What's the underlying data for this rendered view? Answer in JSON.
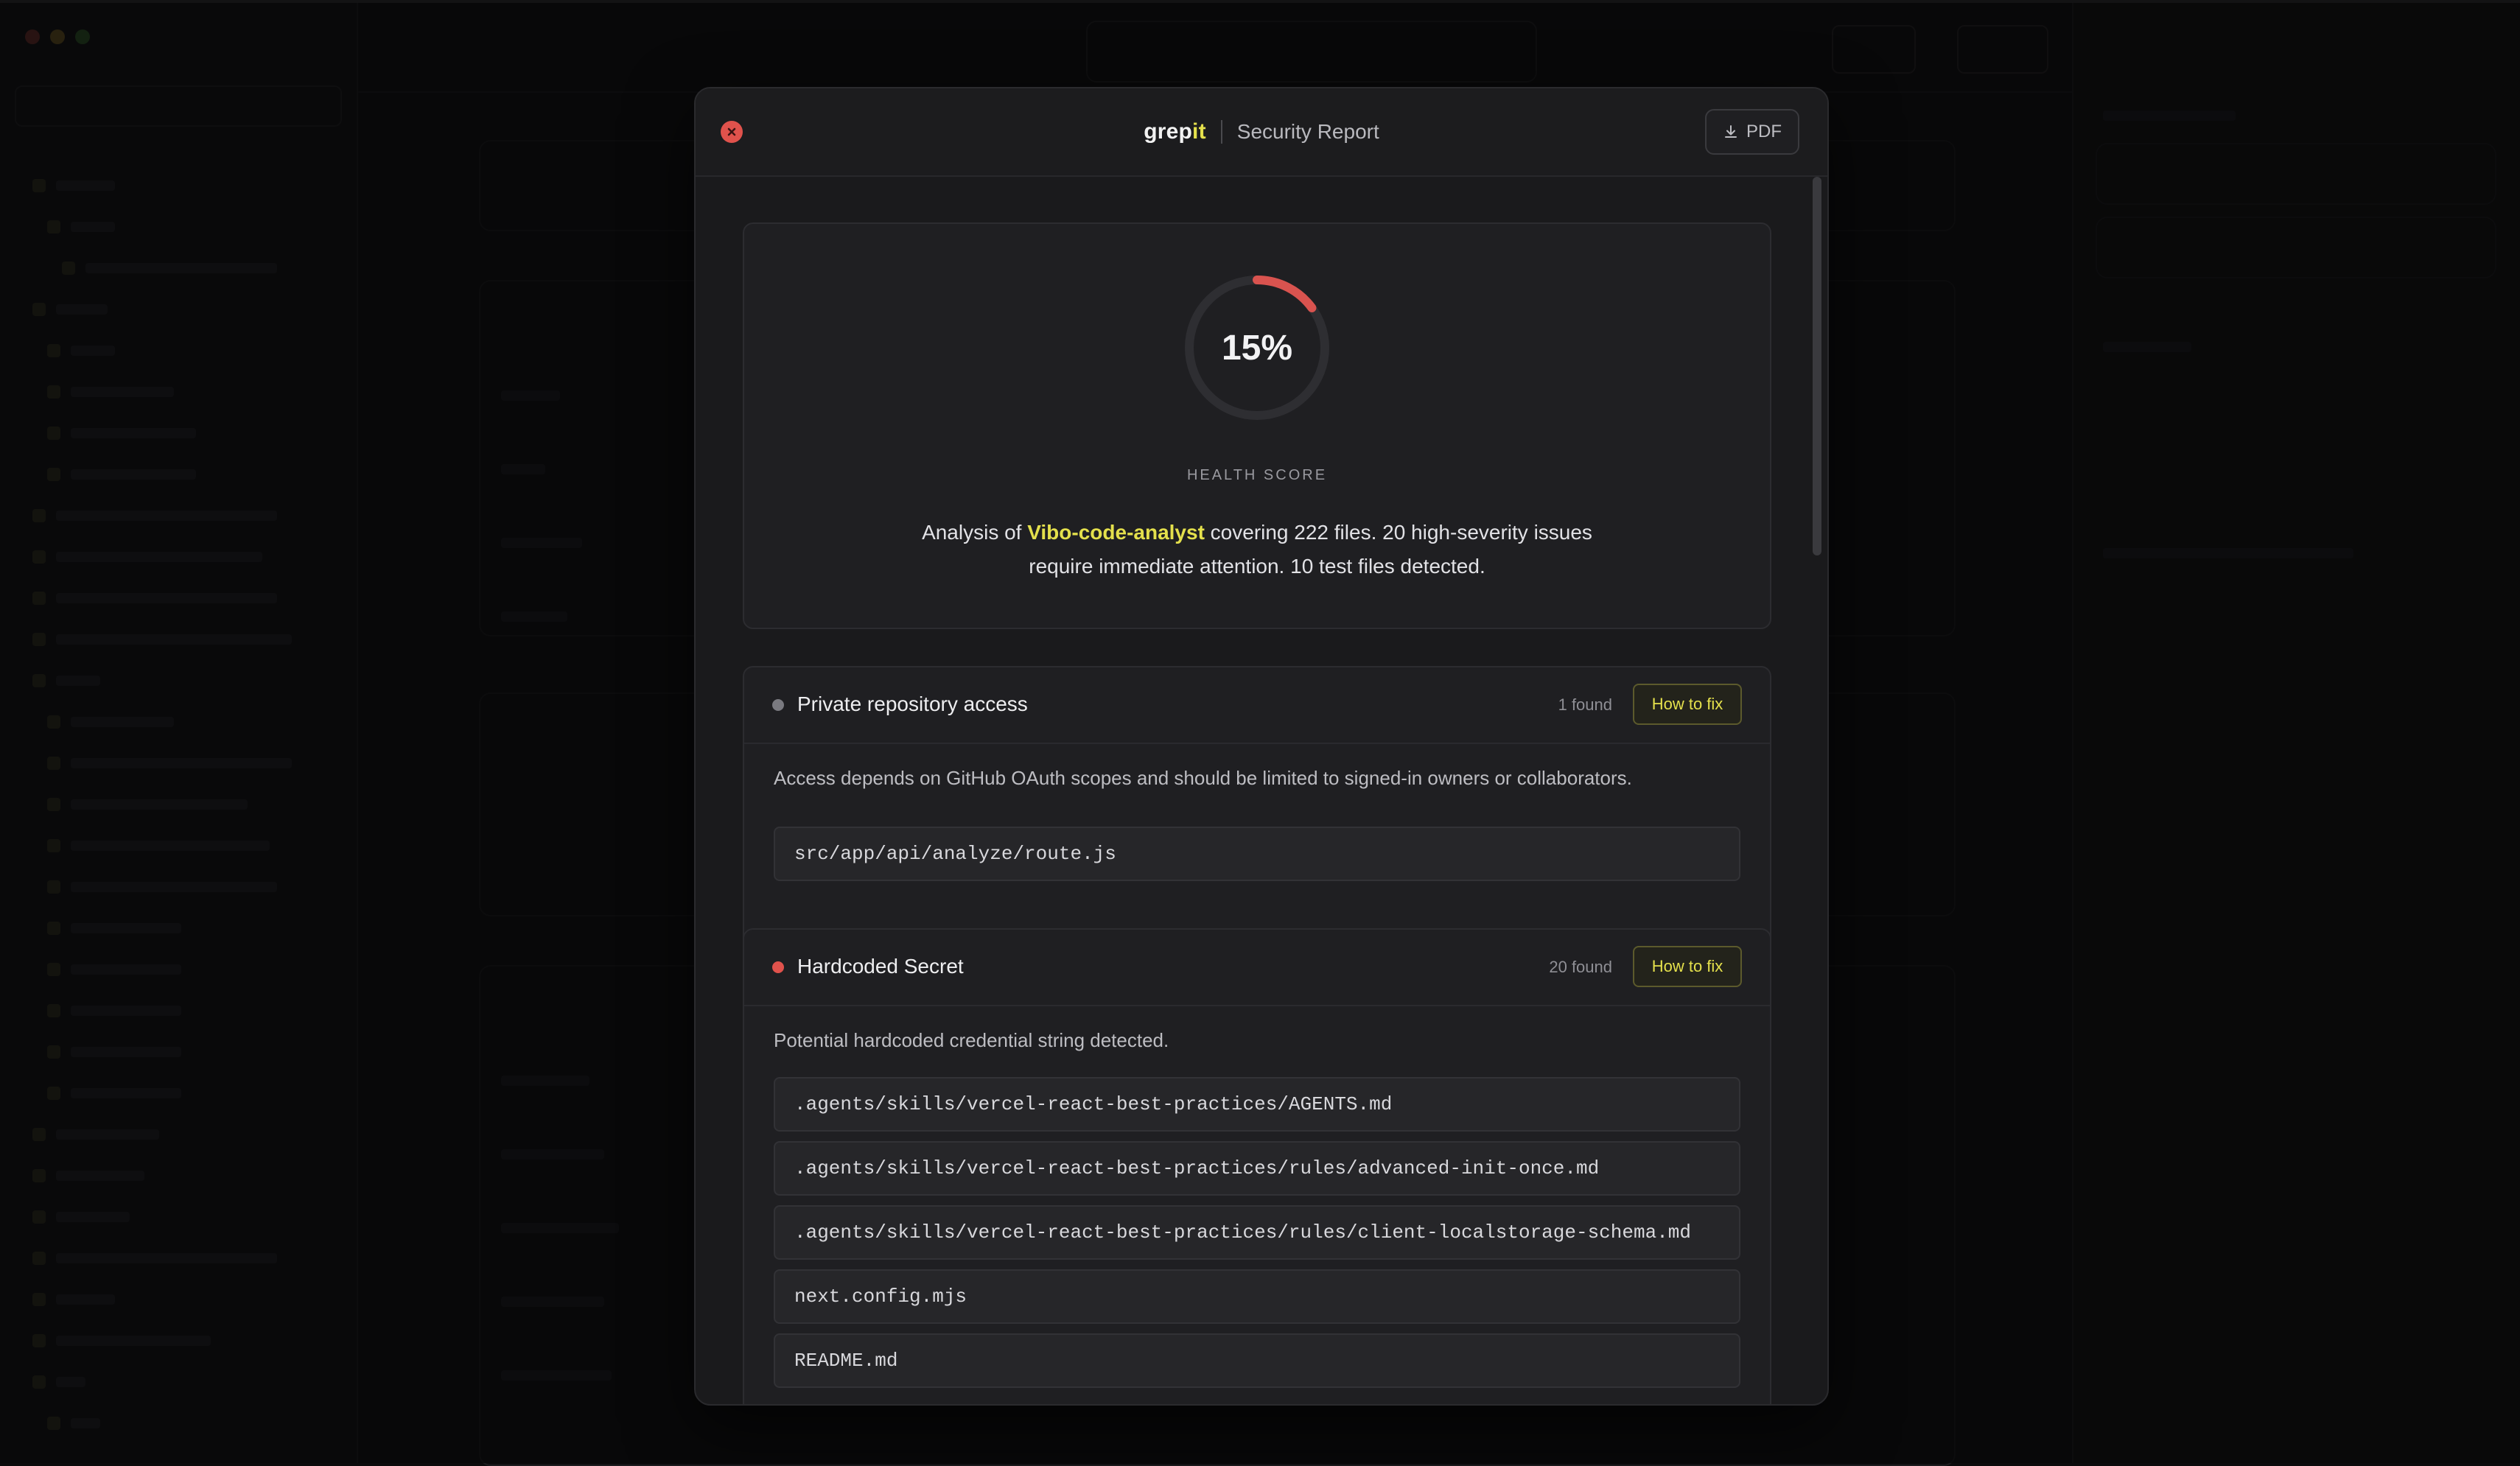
{
  "modal": {
    "brand_prefix": "grep",
    "brand_suffix": "it",
    "title": "Security Report",
    "pdf_label": "PDF",
    "close_icon": "close-icon",
    "download_icon": "download-icon"
  },
  "score": {
    "value_label": "15%",
    "percent": 15,
    "label": "HEALTH SCORE",
    "summary_prefix": "Analysis of ",
    "repo_name": "Vibo-code-analyst",
    "summary_suffix": " covering 222 files. 20 high-severity issues require immediate attention. 10 test files detected.",
    "ring_color": "#d9534f",
    "track_color": "#2e2e32"
  },
  "issues": [
    {
      "name": "Private repository access",
      "found_label": "1 found",
      "fix_label": "How to fix",
      "severity_color": "#7a7a80",
      "description": "Access depends on GitHub OAuth scopes and should be limited to signed-in owners or collaborators.",
      "files": [
        "src/app/api/analyze/route.js"
      ]
    },
    {
      "name": "Hardcoded Secret",
      "found_label": "20 found",
      "fix_label": "How to fix",
      "severity_color": "#e0524c",
      "description": "Potential hardcoded credential string detected.",
      "files": [
        ".agents/skills/vercel-react-best-practices/AGENTS.md",
        ".agents/skills/vercel-react-best-practices/rules/advanced-init-once.md",
        ".agents/skills/vercel-react-best-practices/rules/client-localstorage-schema.md",
        "next.config.mjs",
        "README.md"
      ]
    }
  ],
  "colors": {
    "accent": "#e4e04c",
    "danger": "#e0524c",
    "surface": "#1f1f22"
  }
}
